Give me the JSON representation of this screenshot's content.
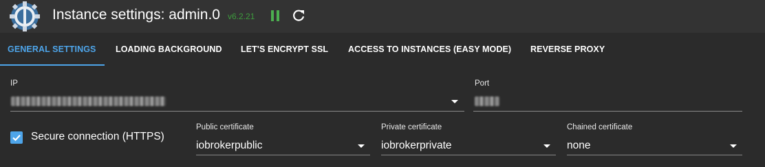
{
  "header": {
    "title": "Instance settings: admin.0",
    "version": "v6.2.21",
    "pause_icon": "pause-icon",
    "reload_icon": "reload-icon",
    "logo_icon": "iobroker-logo",
    "version_color": "#3d9b3d"
  },
  "tabs": [
    {
      "label": "GENERAL SETTINGS",
      "active": true
    },
    {
      "label": "LOADING BACKGROUND"
    },
    {
      "label": "LET'S ENCRYPT SSL"
    },
    {
      "label": "ACCESS TO INSTANCES (EASY MODE)"
    },
    {
      "label": "REVERSE PROXY"
    }
  ],
  "accent_color": "#4ea5ea",
  "form": {
    "ip": {
      "label": "IP",
      "value_blurred": true
    },
    "port": {
      "label": "Port",
      "value_blurred": true
    },
    "secure": {
      "label": "Secure connection (HTTPS)",
      "checked": true
    },
    "public_cert": {
      "label": "Public certificate",
      "value": "iobrokerpublic"
    },
    "private_cert": {
      "label": "Private certificate",
      "value": "iobrokerprivate"
    },
    "chained_cert": {
      "label": "Chained certificate",
      "value": "none"
    }
  }
}
